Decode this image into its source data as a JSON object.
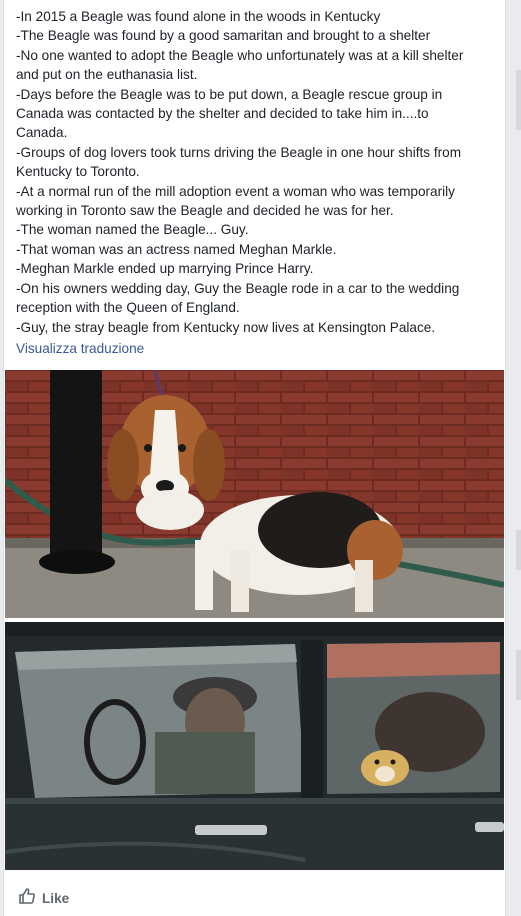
{
  "post": {
    "lines": [
      "-In 2015 a Beagle was found alone in the woods in Kentucky",
      "-The Beagle was found by a good samaritan and brought to a shelter",
      "-No one wanted to adopt the Beagle who unfortunately was at a kill shelter",
      "and put on the euthanasia list.",
      "-Days before the Beagle was to be put down, a Beagle rescue group in",
      "Canada was contacted by the shelter and decided to take him in....to",
      "Canada.",
      "-Groups of dog lovers took turns driving the Beagle in one hour shifts from",
      "Kentucky to Toronto.",
      "-At a normal run of the mill adoption event a woman who was temporarily",
      "working in Toronto saw the Beagle and decided he was for her.",
      "-The woman named the Beagle... Guy.",
      "-That woman was an actress named Meghan Markle.",
      "-Meghan Markle ended up marrying Prince Harry.",
      "-On his owners wedding day, Guy the Beagle rode in a car to the wedding",
      "reception with the Queen of England.",
      "-Guy, the stray beagle from Kentucky now lives at Kensington Palace."
    ],
    "translate_link": "Visualizza traduzione"
  },
  "photos": [
    {
      "subject": "beagle-on-leash-by-brick-wall"
    },
    {
      "subject": "beagle-in-car-window"
    }
  ],
  "actions": {
    "like_label": "Like",
    "like_icon": "thumbs-up-icon"
  },
  "colors": {
    "text": "#1d2129",
    "link": "#385898",
    "muted": "#606770",
    "page_bg": "#e9ebee"
  }
}
